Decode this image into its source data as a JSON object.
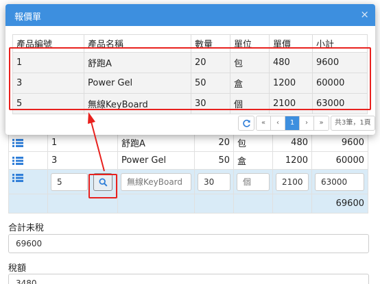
{
  "modal": {
    "title": "報價單",
    "close_glyph": "×",
    "columns": [
      "產品編號",
      "產品名稱",
      "數量",
      "單位",
      "單價",
      "小計"
    ],
    "rows": [
      [
        "1",
        "舒跑A",
        "20",
        "包",
        "480",
        "9600"
      ],
      [
        "3",
        "Power Gel",
        "50",
        "盒",
        "1200",
        "60000"
      ],
      [
        "5",
        "無線KeyBoard",
        "30",
        "個",
        "2100",
        "63000"
      ]
    ],
    "pager": {
      "first": "«",
      "prev": "‹",
      "current": "1",
      "next": "›",
      "last": "»",
      "info": "共3筆，1頁"
    }
  },
  "order": {
    "rows": [
      [
        "1",
        "舒跑A",
        "20",
        "包",
        "480",
        "9600"
      ],
      [
        "3",
        "Power Gel",
        "50",
        "盒",
        "1200",
        "60000"
      ]
    ],
    "edit_row": {
      "product_id": "5",
      "product_name_placeholder": "無線KeyBoard",
      "quantity": "30",
      "unit": "個",
      "unit_price": "2100",
      "subtotal": "63000"
    },
    "total": "69600"
  },
  "fields": {
    "untaxed_label": "合計未稅",
    "untaxed_value": "69600",
    "tax_label": "稅額",
    "tax_value": "3480"
  },
  "colors": {
    "modal_header": "#3d8fdf",
    "highlight_border": "#e8201d",
    "edit_row_bg": "#d9ebf7",
    "list_icon": "#2f7ed8"
  },
  "icons": {
    "row_handle": "list-icon",
    "search": "search-icon",
    "refresh": "refresh-icon",
    "close": "close-icon"
  }
}
